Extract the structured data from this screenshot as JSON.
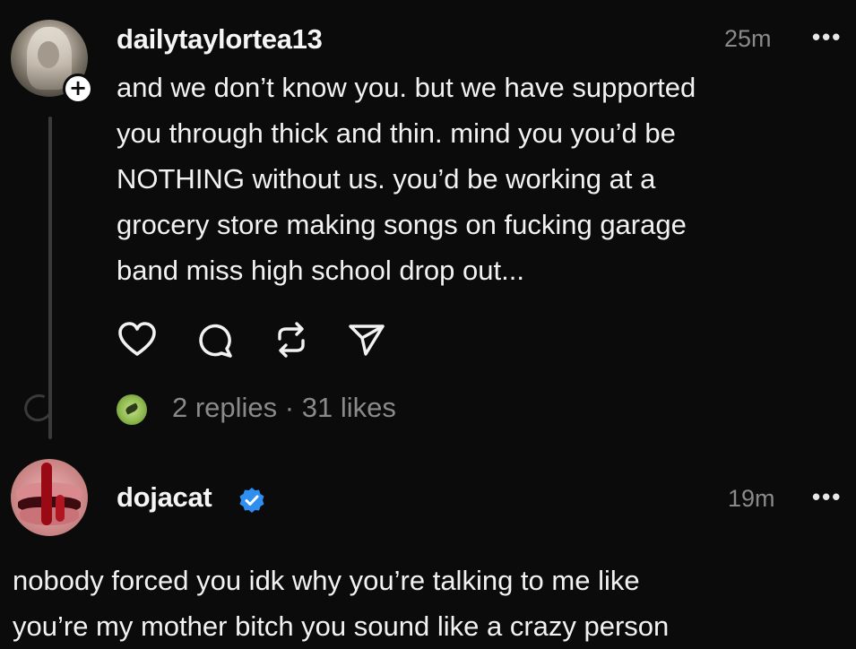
{
  "posts": [
    {
      "username": "dailytaylortea13",
      "timestamp": "25m",
      "more_label": "•••",
      "follow_badge": "+",
      "text_lines": [
        "and we don’t know you. but we have supported",
        "you through thick and thin. mind you you’d be",
        "NOTHING without us. you’d be working at a",
        "grocery store making songs on fucking garage",
        "band miss high school drop out..."
      ],
      "actions": [
        {
          "icon": "heart-icon"
        },
        {
          "icon": "comment-icon"
        },
        {
          "icon": "repost-icon"
        },
        {
          "icon": "share-icon"
        }
      ],
      "stats": "2 replies · 31 likes"
    },
    {
      "username": "dojacat",
      "verified": true,
      "timestamp": "19m",
      "more_label": "•••",
      "text_lines": [
        "nobody forced you idk why you’re talking to me like",
        "you’re my mother bitch you sound like a crazy person"
      ]
    }
  ],
  "colors": {
    "background": "#0b0b0b",
    "text": "#f2f2f2",
    "muted": "#8a8a8a",
    "verified_blue": "#2f8ff0",
    "thread_line": "#3a3a3a"
  }
}
